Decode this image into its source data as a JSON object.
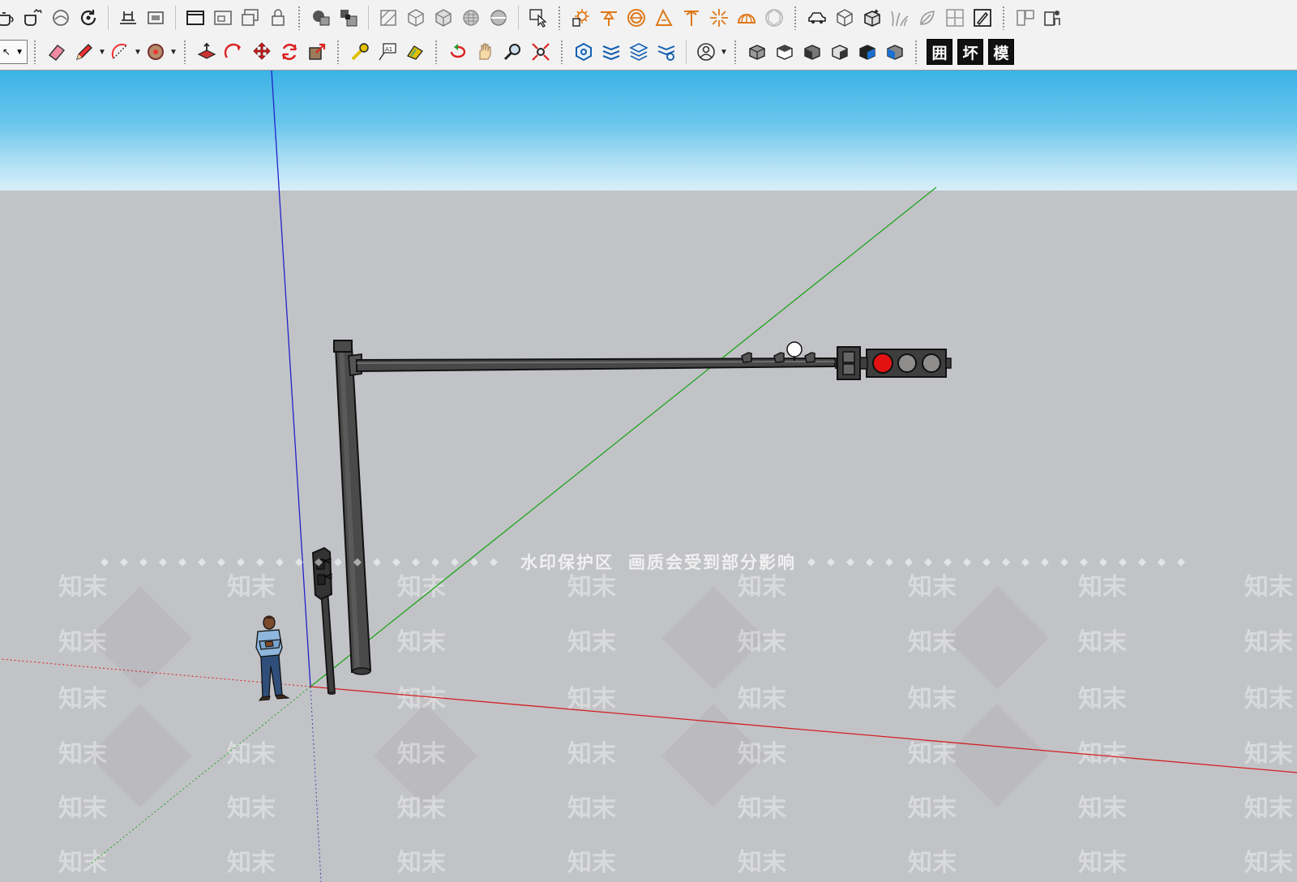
{
  "toolbar": {
    "row1_icons": [
      "teapot-icon",
      "teapot-hand-icon",
      "orbit-soft-icon",
      "refresh-icon",
      "section-plane-icon",
      "section-fill-icon",
      "window-icon",
      "component-window-icon",
      "layers-window-icon",
      "lock-icon",
      "intersect-icon",
      "solid-tools-icon",
      "sandbox-icon",
      "box-x-ray-icon",
      "box-wireframe-icon",
      "box-hidden-line-icon",
      "box-shaded-icon",
      "select-components-icon",
      "sun-settings-icon",
      "cone-icon",
      "circle-rings-icon",
      "slope-icon",
      "pole-icon",
      "sparkle-icon",
      "dome-icon",
      "sphere-icon",
      "car-icon",
      "cube-icon",
      "cube-dark-icon",
      "grass-icon",
      "leaf-icon",
      "grid-split-icon",
      "edit-icon",
      "doc-icon",
      "person-shade-icon"
    ],
    "row2_icons": [
      "eraser-icon",
      "pencil-icon",
      "arc-icon",
      "paint-bucket-icon",
      "push-pull-icon",
      "follow-me-icon",
      "move-icon",
      "rotate-icon",
      "scale-icon",
      "tape-measure-icon",
      "text-icon",
      "paint-icon",
      "orbit-icon",
      "pan-icon",
      "zoom-icon",
      "zoom-extents-icon",
      "stack-icon",
      "multi-layer-icon",
      "layers-flow-icon",
      "layers-settings-icon",
      "user-account-icon",
      "view-iso-icon",
      "view-top-icon",
      "view-front-icon",
      "view-right-icon",
      "view-back-icon",
      "view-left-icon"
    ],
    "text_buttons": [
      "囲",
      "坏",
      "模"
    ]
  },
  "watermark": {
    "banner_left": "水印保护区",
    "banner_right": "画质会受到部分影响",
    "tile_text": "知末"
  },
  "scene": {
    "sky_color": "#3ab3e6",
    "ground_color": "#c2c3c7",
    "axis_colors": {
      "red": "#d42020",
      "green": "#1fa51f",
      "blue": "#2020c8"
    },
    "signal_lights": {
      "red": "#e31212",
      "off": "#8f8e8c"
    }
  }
}
